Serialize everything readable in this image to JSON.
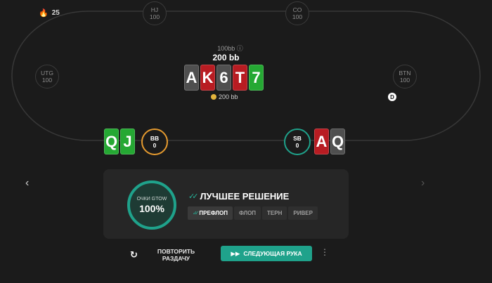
{
  "streak": {
    "icon": "flame-icon",
    "count": "25"
  },
  "seats": {
    "hj": {
      "name": "HJ",
      "stack": "100"
    },
    "co": {
      "name": "CO",
      "stack": "100"
    },
    "utg": {
      "name": "UTG",
      "stack": "100"
    },
    "btn": {
      "name": "BTN",
      "stack": "100"
    },
    "bb": {
      "name": "BB",
      "stack": "0"
    },
    "sb": {
      "name": "SB",
      "stack": "0"
    }
  },
  "dealer_button": "D",
  "pot": {
    "small": "100bb ⓘ",
    "total": "200 bb",
    "bet": "200 bb"
  },
  "board": [
    {
      "rank": "A",
      "suit": "spade"
    },
    {
      "rank": "K",
      "suit": "heart"
    },
    {
      "rank": "6",
      "suit": "spade"
    },
    {
      "rank": "T",
      "suit": "heart"
    },
    {
      "rank": "7",
      "suit": "club"
    }
  ],
  "hero_hand": [
    {
      "rank": "Q",
      "suit": "club"
    },
    {
      "rank": "J",
      "suit": "club"
    }
  ],
  "villain_hand": [
    {
      "rank": "A",
      "suit": "heart"
    },
    {
      "rank": "Q",
      "suit": "spade"
    }
  ],
  "nav": {
    "left": "‹",
    "right": "›"
  },
  "result": {
    "gauge_label": "ОЧКИ GTOW",
    "gauge_value": "100%",
    "gauge_fill": 1.0,
    "best_label": "ЛУЧШЕЕ РЕШЕНИЕ",
    "streets": [
      "ПРЕФЛОП",
      "ФЛОП",
      "ТЕРН",
      "РИВЕР"
    ],
    "active_street": 0
  },
  "actions": {
    "repeat_icon": "↻",
    "repeat_label_1": "ПОВТОРИТЬ",
    "repeat_label_2": "РАЗДАЧУ",
    "next_icon": "▶▶",
    "next_label": "СЛЕДУЮЩАЯ РУКА",
    "more_icon": "⋮"
  },
  "colors": {
    "accent": "#1fa28b",
    "hero_ring": "#e59a2f",
    "spade": "#4f4f4f",
    "heart": "#b81c22",
    "club": "#25a833"
  }
}
